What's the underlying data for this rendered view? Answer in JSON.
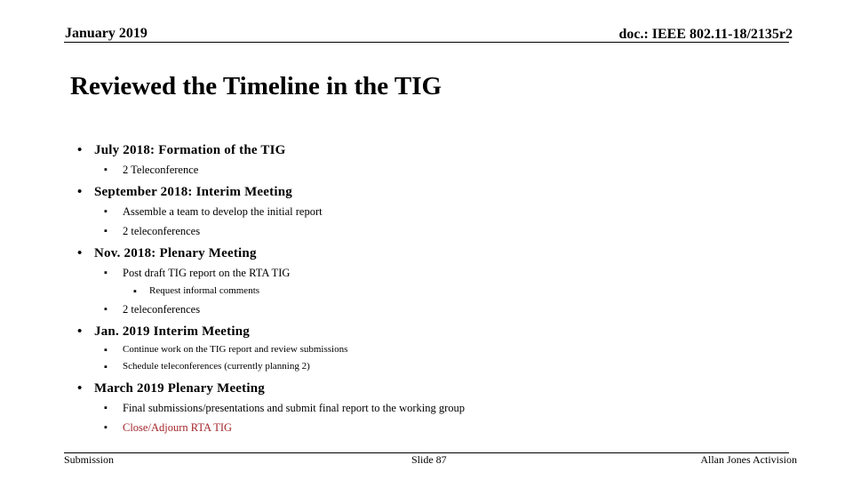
{
  "header": {
    "date": "January 2019",
    "doc_id": "doc.: IEEE 802.11-18/2135r2"
  },
  "title": "Reviewed the Timeline in the TIG",
  "bullet_glyph": "•",
  "sub_bullet_glyph": "▪",
  "items": [
    {
      "label": "July 2018: Formation of the TIG",
      "children": [
        {
          "label": "2 Teleconference"
        }
      ]
    },
    {
      "label": "September 2018: Interim Meeting",
      "children": [
        {
          "label": "Assemble a team to develop the initial report"
        },
        {
          "label": "2 teleconferences"
        }
      ]
    },
    {
      "label": "Nov. 2018: Plenary Meeting",
      "children": [
        {
          "label": "Post draft TIG report on the RTA TIG",
          "children": [
            {
              "label": "Request informal comments"
            }
          ]
        },
        {
          "label": "2 teleconferences"
        }
      ]
    },
    {
      "label": "Jan. 2019 Interim Meeting",
      "children": [
        {
          "label": "Continue work on the TIG report and review submissions"
        },
        {
          "label": "Schedule teleconferences (currently planning 2)"
        }
      ]
    },
    {
      "label": "March 2019 Plenary Meeting",
      "children": [
        {
          "label": "Final submissions/presentations and submit final report to the working group"
        },
        {
          "label": "Close/Adjourn RTA TIG",
          "color": "#a3252a"
        }
      ]
    }
  ],
  "footer": {
    "left": "Submission",
    "center": "Slide 87",
    "right": "Allan Jones Activision"
  }
}
